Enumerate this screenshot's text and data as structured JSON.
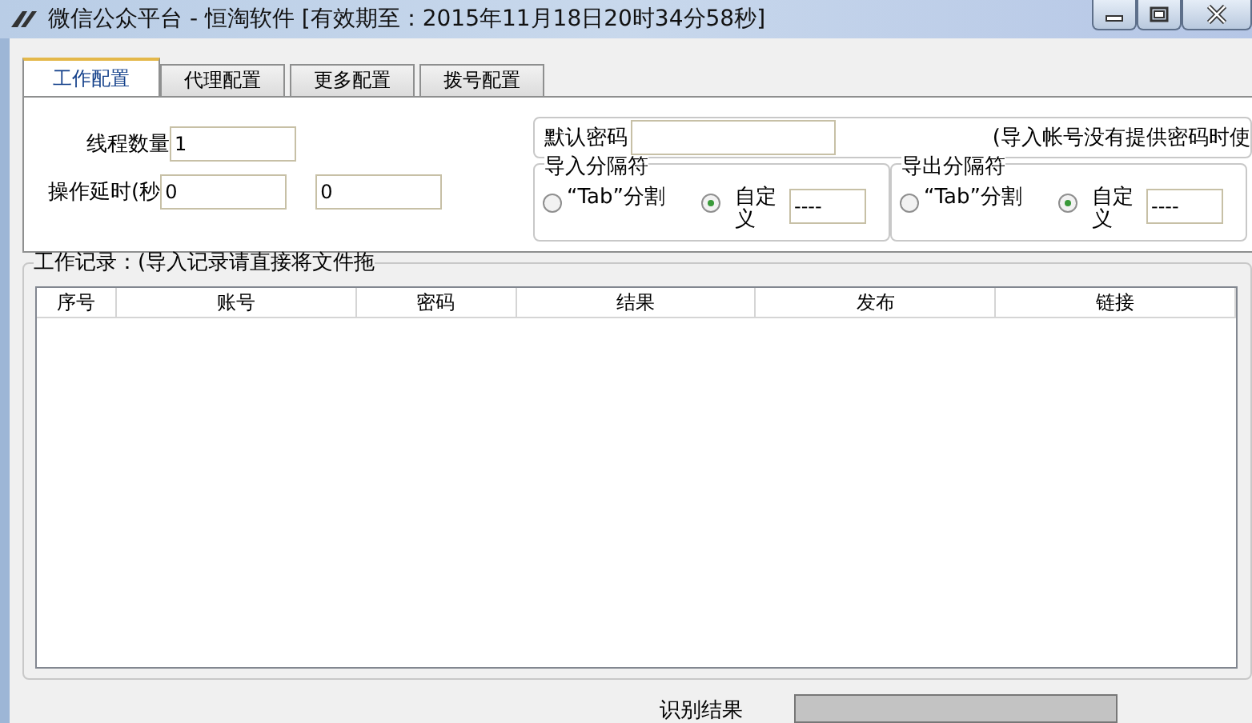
{
  "window": {
    "title": "微信公众平台 - 恒淘软件 [有效期至：2015年11月18日20时34分58秒]"
  },
  "tabs": [
    {
      "label": "工作配置",
      "selected": true
    },
    {
      "label": "代理配置",
      "selected": false
    },
    {
      "label": "更多配置",
      "selected": false
    },
    {
      "label": "拨号配置",
      "selected": false
    }
  ],
  "thread_count": {
    "label": "线程数量",
    "value": "1"
  },
  "delay": {
    "label": "操作延时(秒",
    "value_min": "0",
    "value_max": "0"
  },
  "default_password": {
    "label": "默认密码",
    "note": "(导入帐号没有提供密码时使"
  },
  "separators": [
    {
      "legend": "导入分隔符",
      "custom_value": "----",
      "options": [
        {
          "label": "“Tab”分割",
          "selected": false
        },
        {
          "label": "自定义",
          "selected": true
        }
      ]
    },
    {
      "legend": "导出分隔符",
      "custom_value": "----",
      "options": [
        {
          "label": "“Tab”分割",
          "selected": false
        },
        {
          "label": "自定义",
          "selected": true
        }
      ]
    }
  ],
  "work_log": {
    "legend": "工作记录：(导入记录请直接将文件拖",
    "columns": [
      "序号",
      "账号",
      "密码",
      "结果",
      "发布",
      "链接"
    ]
  },
  "recognition": {
    "label": "识别结果"
  }
}
